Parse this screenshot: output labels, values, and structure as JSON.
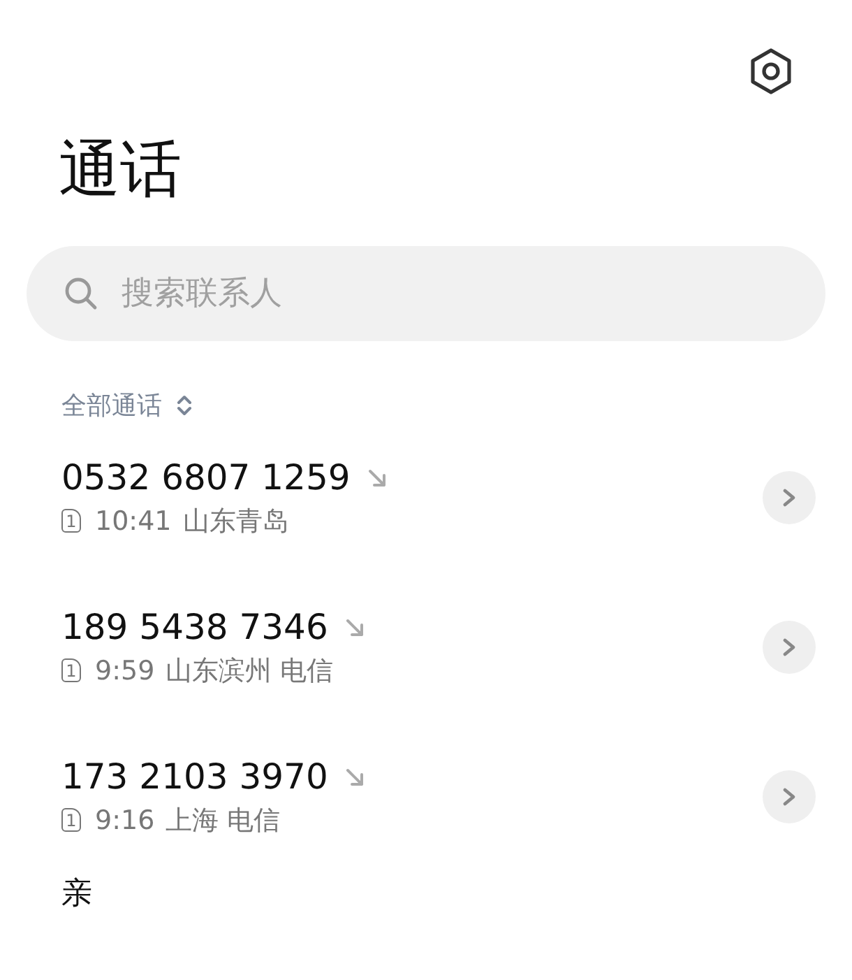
{
  "title": "通话",
  "search": {
    "placeholder": "搜索联系人"
  },
  "filter": {
    "label": "全部通话"
  },
  "calls": [
    {
      "number": "0532 6807 1259",
      "sim": "1",
      "time": "10:41",
      "location": "山东青岛"
    },
    {
      "number": "189 5438 7346",
      "sim": "1",
      "time": "9:59",
      "location": "山东滨州 电信"
    },
    {
      "number": "173 2103 3970",
      "sim": "1",
      "time": "9:16",
      "location": "上海 电信"
    }
  ],
  "section_header": "亲"
}
